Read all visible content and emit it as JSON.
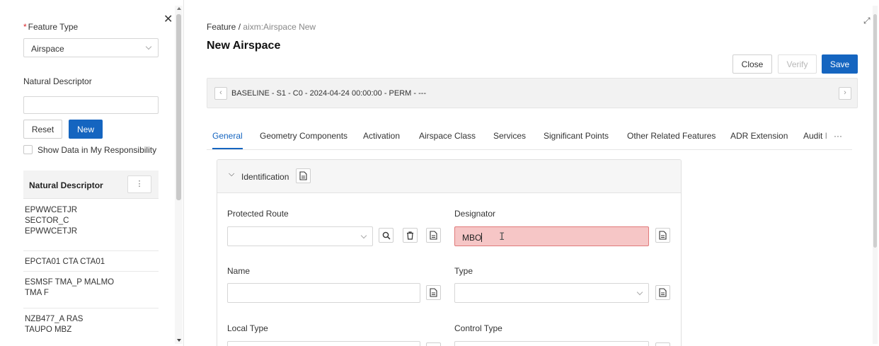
{
  "left_panel": {
    "feature_type_label": "Feature Type",
    "required_mark": "*",
    "feature_type_value": "Airspace",
    "natural_descriptor_label": "Natural Descriptor",
    "natural_descriptor_value": "",
    "reset_label": "Reset",
    "new_label": "New",
    "show_data_label": "Show Data in My Responsibility",
    "show_data_checked": false,
    "grid_header": "Natural Descriptor",
    "rows": [
      "EPWWCETJR SECTOR_C EPWWCETJR",
      "EPCTA01 CTA CTA01",
      "ESMSF TMA_P MALMO TMA F",
      "NZB477_A RAS TAUPO MBZ"
    ]
  },
  "breadcrumb": {
    "root": "Feature",
    "separator": "/",
    "current": "aixm:Airspace New"
  },
  "page_title": "New Airspace",
  "actions": {
    "close_label": "Close",
    "verify_label": "Verify",
    "save_label": "Save"
  },
  "baseline": {
    "text": "BASELINE - S1 - C0 - 2024-04-24 00:00:00 - PERM - ---"
  },
  "tabs": [
    "General",
    "Geometry Components",
    "Activation",
    "Airspace Class",
    "Services",
    "Significant Points",
    "Other Related Features",
    "ADR Extension",
    "Audit I"
  ],
  "tabs_more": "···",
  "section": {
    "title": "Identification",
    "fields": {
      "protected_route": {
        "label": "Protected Route",
        "value": ""
      },
      "designator": {
        "label": "Designator",
        "value": "MBO"
      },
      "name": {
        "label": "Name",
        "value": ""
      },
      "type": {
        "label": "Type",
        "value": ""
      },
      "local_type": {
        "label": "Local Type",
        "value": ""
      },
      "control_type": {
        "label": "Control Type",
        "value": ""
      }
    }
  },
  "colors": {
    "accent": "#1565c0",
    "error_fill": "#f6c6c6",
    "error_border": "#e07a7a"
  }
}
